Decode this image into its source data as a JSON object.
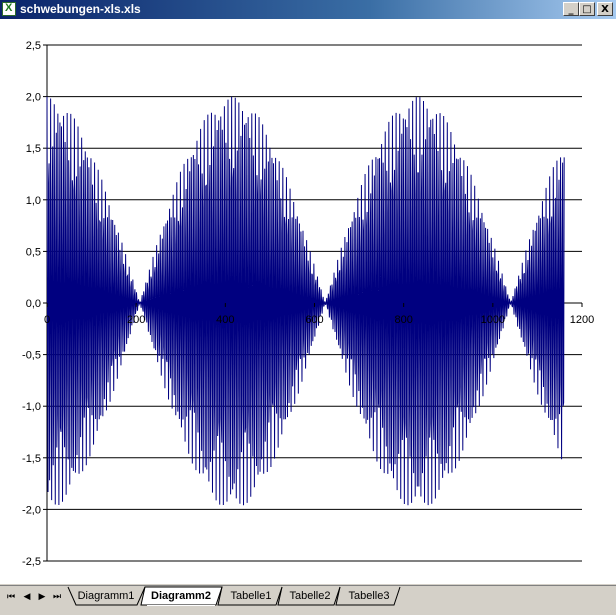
{
  "window": {
    "title": "schwebungen-xls.xls"
  },
  "controls": {
    "minimize": "_",
    "maximize": "□",
    "close": "X"
  },
  "sheet_tabs": {
    "nav": [
      "⏮",
      "◀",
      "▶",
      "⏭"
    ],
    "tabs": [
      {
        "label": "Diagramm1",
        "active": false
      },
      {
        "label": "Diagramm2",
        "active": true
      },
      {
        "label": "Tabelle1",
        "active": false
      },
      {
        "label": "Tabelle2",
        "active": false
      },
      {
        "label": "Tabelle3",
        "active": false
      }
    ]
  },
  "chart_data": {
    "type": "line",
    "title": "",
    "xlabel": "",
    "ylabel": "",
    "xlim": [
      0,
      1200
    ],
    "ylim": [
      -2.5,
      2.5
    ],
    "x_ticks": [
      "0",
      "200",
      "400",
      "600",
      "800",
      "1000",
      "1200"
    ],
    "y_ticks": [
      "2,5",
      "2,0",
      "1,5",
      "1,0",
      "0,5",
      "0,0",
      "-0,5",
      "-1,0",
      "-1,5",
      "-2,0",
      "-2,5"
    ],
    "grid": true,
    "series": [
      {
        "color": "#000080",
        "description_points": {
          "x_start": 0,
          "x_end": 1160,
          "amplitude_max": 2.0,
          "envelope_nodes_x": [
            210,
            625,
            1040
          ],
          "envelope_peaks_x": [
            0,
            418,
            832
          ],
          "end_amplitude": 1.45
        }
      }
    ]
  }
}
